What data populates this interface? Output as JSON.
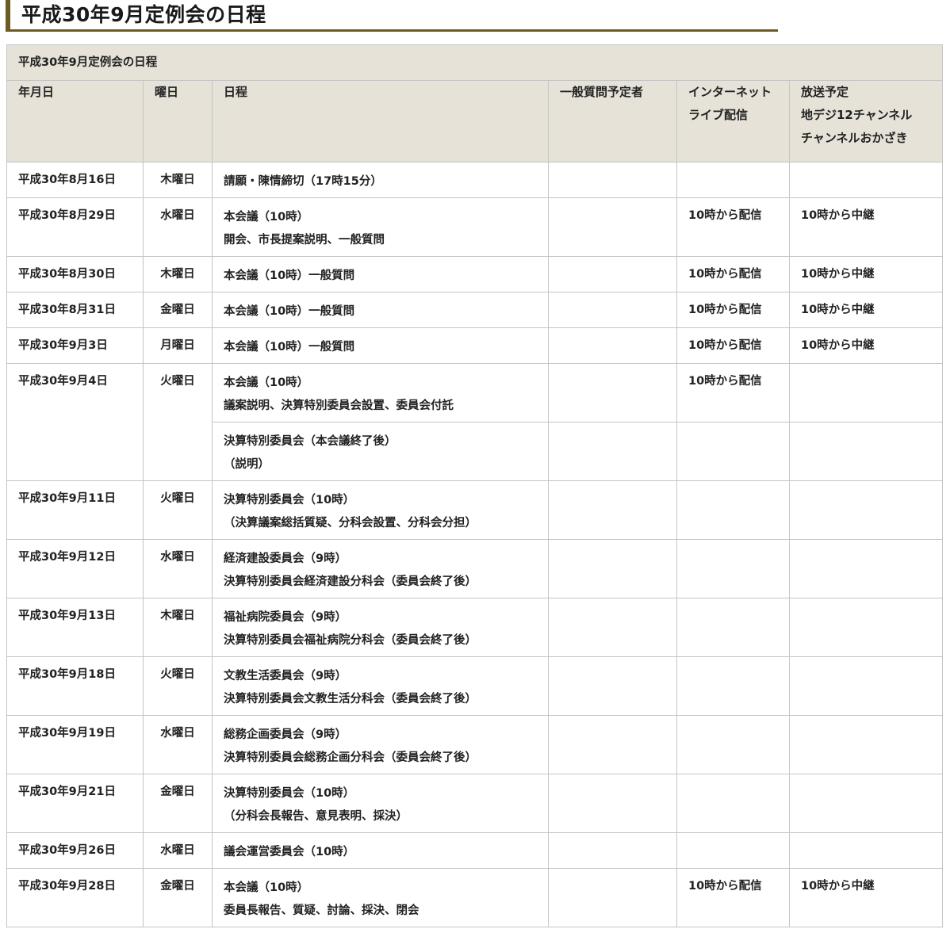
{
  "title": "平成30年9月定例会の日程",
  "table": {
    "caption": "平成30年9月定例会の日程",
    "headers": {
      "date": "年月日",
      "weekday": "曜日",
      "schedule": "日程",
      "questioners": "一般質問予定者",
      "internet": [
        "インターネット",
        "ライブ配信"
      ],
      "broadcast": [
        "放送予定",
        "地デジ12チャンネル",
        "チャンネルおかざき"
      ]
    },
    "rows": [
      {
        "date": "平成30年8月16日",
        "weekday": "木曜日",
        "schedule": [
          "請願・陳情締切（17時15分）"
        ],
        "questioners": "",
        "internet": "",
        "broadcast": ""
      },
      {
        "date": "平成30年8月29日",
        "weekday": "水曜日",
        "schedule": [
          "本会議（10時）",
          "開会、市長提案説明、一般質問"
        ],
        "questioners": "",
        "internet": "10時から配信",
        "broadcast": "10時から中継"
      },
      {
        "date": "平成30年8月30日",
        "weekday": "木曜日",
        "schedule": [
          "本会議（10時）一般質問"
        ],
        "questioners": "",
        "internet": "10時から配信",
        "broadcast": "10時から中継"
      },
      {
        "date": "平成30年8月31日",
        "weekday": "金曜日",
        "schedule": [
          "本会議（10時）一般質問"
        ],
        "questioners": "",
        "internet": "10時から配信",
        "broadcast": "10時から中継"
      },
      {
        "date": "平成30年9月3日",
        "weekday": "月曜日",
        "schedule": [
          "本会議（10時）一般質問"
        ],
        "questioners": "",
        "internet": "10時から配信",
        "broadcast": "10時から中継"
      },
      {
        "date": "平成30年9月4日",
        "weekday": "火曜日",
        "schedule": [
          "本会議（10時）",
          "議案説明、決算特別委員会設置、委員会付託"
        ],
        "questioners": "",
        "internet": "10時から配信",
        "broadcast": ""
      },
      {
        "date": "",
        "weekday": "",
        "schedule": [
          "決算特別委員会（本会議終了後）",
          "（説明）"
        ],
        "questioners": "",
        "internet": "",
        "broadcast": ""
      },
      {
        "date": "平成30年9月11日",
        "weekday": "火曜日",
        "schedule": [
          "決算特別委員会（10時）",
          "（決算議案総括質疑、分科会設置、分科会分担）"
        ],
        "questioners": "",
        "internet": "",
        "broadcast": ""
      },
      {
        "date": "平成30年9月12日",
        "weekday": "水曜日",
        "schedule": [
          "経済建設委員会（9時）",
          "決算特別委員会経済建設分科会（委員会終了後）"
        ],
        "questioners": "",
        "internet": "",
        "broadcast": ""
      },
      {
        "date": "平成30年9月13日",
        "weekday": "木曜日",
        "schedule": [
          "福祉病院委員会（9時）",
          "決算特別委員会福祉病院分科会（委員会終了後）"
        ],
        "questioners": "",
        "internet": "",
        "broadcast": ""
      },
      {
        "date": "平成30年9月18日",
        "weekday": "火曜日",
        "schedule": [
          "文教生活委員会（9時）",
          "決算特別委員会文教生活分科会（委員会終了後）"
        ],
        "questioners": "",
        "internet": "",
        "broadcast": ""
      },
      {
        "date": "平成30年9月19日",
        "weekday": "水曜日",
        "schedule": [
          "総務企画委員会（9時）",
          "決算特別委員会総務企画分科会（委員会終了後）"
        ],
        "questioners": "",
        "internet": "",
        "broadcast": ""
      },
      {
        "date": "平成30年9月21日",
        "weekday": "金曜日",
        "schedule": [
          "決算特別委員会（10時）",
          "（分科会長報告、意見表明、採決）"
        ],
        "questioners": "",
        "internet": "",
        "broadcast": ""
      },
      {
        "date": "平成30年9月26日",
        "weekday": "水曜日",
        "schedule": [
          "議会運営委員会（10時）"
        ],
        "questioners": "",
        "internet": "",
        "broadcast": ""
      },
      {
        "date": "平成30年9月28日",
        "weekday": "金曜日",
        "schedule": [
          "本会議（10時）",
          "委員長報告、質疑、討論、採決、閉会"
        ],
        "questioners": "",
        "internet": "10時から配信",
        "broadcast": "10時から中継"
      }
    ]
  }
}
